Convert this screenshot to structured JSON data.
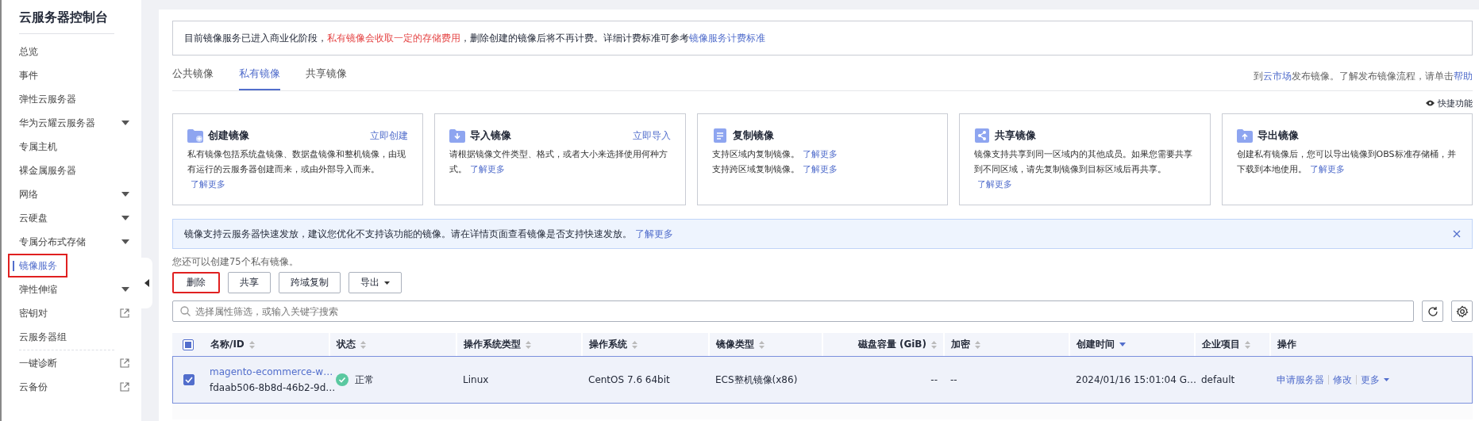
{
  "sidebar": {
    "title": "云服务器控制台",
    "items": [
      {
        "label": "总览",
        "kind": "plain",
        "selected": false,
        "highlighted": false
      },
      {
        "label": "事件",
        "kind": "plain",
        "selected": false,
        "highlighted": false
      },
      {
        "label": "弹性云服务器",
        "kind": "plain",
        "selected": false,
        "highlighted": false
      },
      {
        "label": "华为云耀云服务器",
        "kind": "expandable",
        "selected": false,
        "highlighted": false
      },
      {
        "label": "专属主机",
        "kind": "plain",
        "selected": false,
        "highlighted": false
      },
      {
        "label": "裸金属服务器",
        "kind": "plain",
        "selected": false,
        "highlighted": false
      },
      {
        "label": "网络",
        "kind": "expandable",
        "selected": false,
        "highlighted": false
      },
      {
        "label": "云硬盘",
        "kind": "expandable",
        "selected": false,
        "highlighted": false
      },
      {
        "label": "专属分布式存储",
        "kind": "expandable",
        "selected": false,
        "highlighted": false
      },
      {
        "label": "镜像服务",
        "kind": "plain",
        "selected": true,
        "highlighted": true
      },
      {
        "label": "弹性伸缩",
        "kind": "expandable",
        "selected": false,
        "highlighted": false
      },
      {
        "label": "密钥对",
        "kind": "external",
        "selected": false,
        "highlighted": false
      },
      {
        "label": "云服务器组",
        "kind": "plain",
        "selected": false,
        "highlighted": false,
        "divider_before": false
      },
      {
        "label": "一键诊断",
        "kind": "external",
        "selected": false,
        "highlighted": false,
        "divider_before": true
      },
      {
        "label": "云备份",
        "kind": "external",
        "selected": false,
        "highlighted": false
      }
    ]
  },
  "notice": [
    {
      "text": "目前镜像服务已进入商业化阶段，",
      "kind": "plain"
    },
    {
      "text": "私有镜像会收取一定的存储费用",
      "kind": "warn"
    },
    {
      "text": "，删除创建的镜像后将不再计费。详细计费标准可参考",
      "kind": "plain"
    },
    {
      "text": "镜像服务计费标准",
      "kind": "link"
    }
  ],
  "tabs": [
    {
      "label": "公共镜像",
      "selected": false
    },
    {
      "label": "私有镜像",
      "selected": true
    },
    {
      "label": "共享镜像",
      "selected": false
    }
  ],
  "help": [
    {
      "text": "到",
      "kind": "plain"
    },
    {
      "text": "云市场",
      "kind": "link"
    },
    {
      "text": "发布镜像。了解发布镜像流程，请单击",
      "kind": "plain"
    },
    {
      "text": "帮助",
      "kind": "link"
    }
  ],
  "quick_functions": "快捷功能",
  "cards": [
    {
      "title": "创建镜像",
      "action": "立即创建",
      "lines": [
        [
          {
            "text": "私有镜像包括系统盘镜像、数据盘镜像和整机镜像，由现有运行的云服务器创建而来，或由外部导入而来。",
            "kind": "plain"
          },
          {
            "text": "了解更多",
            "kind": "link"
          }
        ]
      ]
    },
    {
      "title": "导入镜像",
      "action": "立即导入",
      "lines": [
        [
          {
            "text": "请根据镜像文件类型、格式，或者大小来选择使用何种方式。",
            "kind": "plain"
          },
          {
            "text": "了解更多",
            "kind": "link"
          }
        ]
      ]
    },
    {
      "title": "复制镜像",
      "lines": [
        [
          {
            "text": "支持区域内复制镜像。",
            "kind": "plain"
          },
          {
            "text": "了解更多",
            "kind": "link"
          }
        ],
        [
          {
            "text": "支持跨区域复制镜像。",
            "kind": "plain"
          },
          {
            "text": "了解更多",
            "kind": "link"
          }
        ]
      ]
    },
    {
      "title": "共享镜像",
      "lines": [
        [
          {
            "text": "镜像支持共享到同一区域内的其他成员。如果您需要共享到不同区域，请先复制镜像到目标区域后再共享。",
            "kind": "plain"
          },
          {
            "text": "了解更多",
            "kind": "link"
          }
        ]
      ]
    },
    {
      "title": "导出镜像",
      "lines": [
        [
          {
            "text": "创建私有镜像后，您可以导出镜像到OBS标准存储桶，并下载到本地使用。",
            "kind": "plain"
          },
          {
            "text": "了解更多",
            "kind": "link"
          }
        ]
      ]
    }
  ],
  "banner": {
    "text": "镜像支持云服务器快速发放，建议您优化不支持该功能的镜像。请在详情页面查看镜像是否支持快速发放。",
    "link": "了解更多"
  },
  "quota": "您还可以创建75个私有镜像。",
  "buttons": [
    {
      "label": "删除",
      "dropdown": false,
      "highlighted": true
    },
    {
      "label": "共享",
      "dropdown": false,
      "highlighted": false
    },
    {
      "label": "跨域复制",
      "dropdown": false,
      "highlighted": false
    },
    {
      "label": "导出",
      "dropdown": true,
      "highlighted": false
    }
  ],
  "search": {
    "placeholder": "选择属性筛选，或输入关键字搜索"
  },
  "table": {
    "all_checked": false,
    "some_checked": true,
    "columns": [
      {
        "label": "名称/ID",
        "kind": "text",
        "sorted": false
      },
      {
        "label": "状态",
        "kind": "text",
        "sorted": false
      },
      {
        "label": "操作系统类型",
        "kind": "text",
        "sorted": false
      },
      {
        "label": "操作系统",
        "kind": "text",
        "sorted": false
      },
      {
        "label": "镜像类型",
        "kind": "text",
        "sorted": false
      },
      {
        "label": "磁盘容量 (GiB)",
        "kind": "number",
        "sorted": false
      },
      {
        "label": "加密",
        "kind": "text",
        "sorted": false
      },
      {
        "label": "创建时间",
        "kind": "text",
        "sorted": true
      },
      {
        "label": "企业项目",
        "kind": "text",
        "sorted": false
      },
      {
        "label": "操作",
        "kind": "action"
      }
    ],
    "rows": [
      {
        "checked": true,
        "selected": true,
        "name": "magento-ecommerce-w…",
        "id": "fdaab506-8b8d-46b2-9d…",
        "status": "正常",
        "os_type": "Linux",
        "os": "CentOS 7.6 64bit",
        "image_type": "ECS整机镜像(x86)",
        "disk": "--",
        "encryption": "--",
        "created": "2024/01/16 15:01:04 G…",
        "project": "default",
        "actions": [
          {
            "label": "申请服务器",
            "dropdown": false
          },
          {
            "label": "修改",
            "dropdown": false
          },
          {
            "label": "更多",
            "dropdown": true
          }
        ]
      }
    ]
  }
}
